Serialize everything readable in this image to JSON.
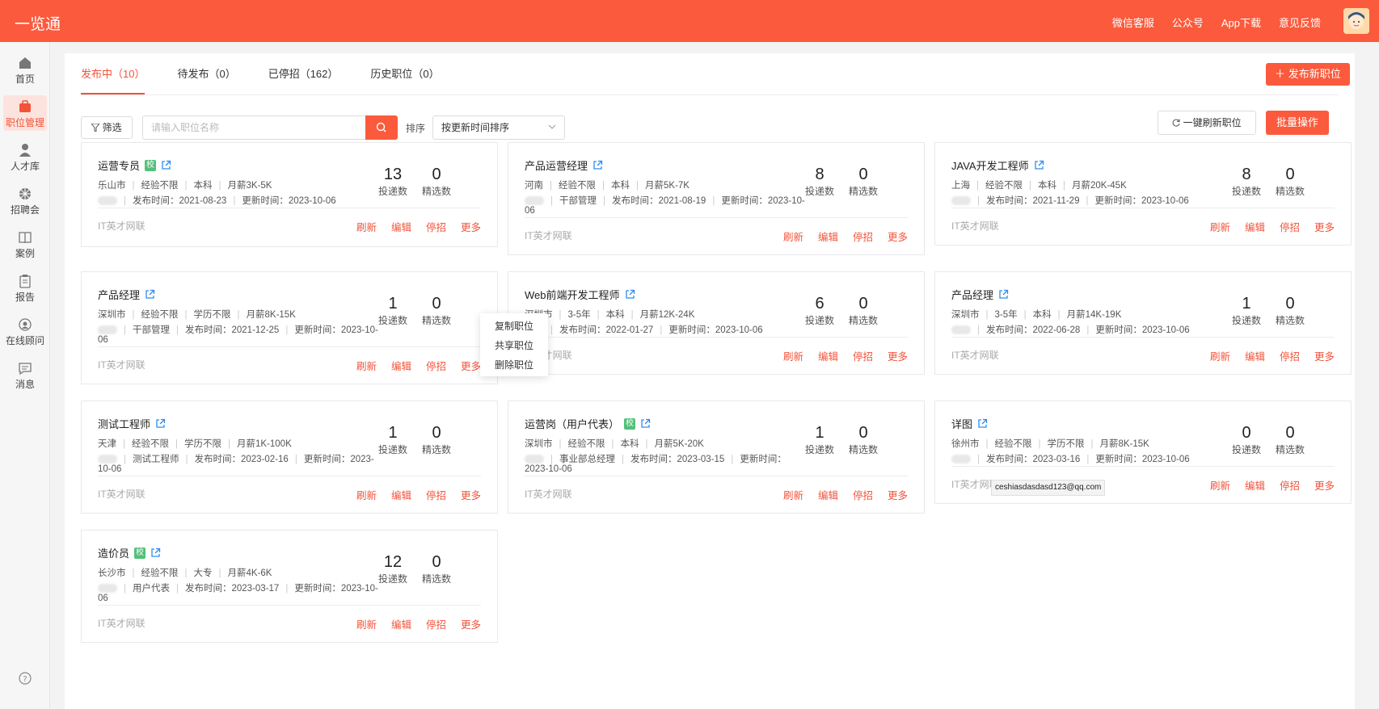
{
  "app": {
    "logo": "一览通",
    "top_links": [
      "微信客服",
      "公众号",
      "App下载",
      "意见反馈"
    ]
  },
  "sidebar": {
    "items": [
      {
        "label": "首页",
        "icon": "home-icon"
      },
      {
        "label": "职位管理",
        "icon": "briefcase-icon",
        "active": true
      },
      {
        "label": "人才库",
        "icon": "person-icon"
      },
      {
        "label": "招聘会",
        "icon": "fair-icon"
      },
      {
        "label": "案例",
        "icon": "book-icon"
      },
      {
        "label": "报告",
        "icon": "clipboard-icon"
      },
      {
        "label": "在线顾问",
        "icon": "consultant-icon"
      },
      {
        "label": "消息",
        "icon": "message-icon"
      }
    ],
    "help_icon": "help-icon"
  },
  "tabs": [
    {
      "label": "发布中（10）",
      "active": true
    },
    {
      "label": "待发布（0）"
    },
    {
      "label": "已停招（162）"
    },
    {
      "label": "历史职位（0）"
    }
  ],
  "toolbar": {
    "publish_label": "发布新职位",
    "filter_label": "筛选",
    "search_placeholder": "请输入职位名称",
    "sort_label": "排序",
    "sort_value": "按更新时间排序",
    "refresh_all_label": "一键刷新职位",
    "batch_label": "批量操作"
  },
  "labels": {
    "delivered": "投递数",
    "selected": "精选数",
    "source": "IT英才网联",
    "refresh": "刷新",
    "edit": "编辑",
    "pause": "停招",
    "more": "更多"
  },
  "cards": [
    {
      "title": "运营专员",
      "badge": "校",
      "city": "乐山市",
      "exp": "经验不限",
      "edu": "本科",
      "salary": "月薪3K-5K",
      "dept": "",
      "publish": "发布时间：2021-08-23",
      "update": "更新时间：2023-10-06",
      "delivered": "13",
      "selected": "0"
    },
    {
      "title": "产品运营经理",
      "badge": "",
      "city": "河南",
      "exp": "经验不限",
      "edu": "本科",
      "salary": "月薪5K-7K",
      "dept": "干部管理",
      "publish": "发布时间：2021-08-19",
      "update": "更新时间：2023-10-06",
      "delivered": "8",
      "selected": "0"
    },
    {
      "title": "JAVA开发工程师",
      "badge": "",
      "city": "上海",
      "exp": "经验不限",
      "edu": "本科",
      "salary": "月薪20K-45K",
      "dept": "",
      "publish": "发布时间：2021-11-29",
      "update": "更新时间：2023-10-06",
      "delivered": "8",
      "selected": "0"
    },
    {
      "title": "产品经理",
      "badge": "",
      "city": "深圳市",
      "exp": "经验不限",
      "edu": "学历不限",
      "salary": "月薪8K-15K",
      "dept": "干部管理",
      "publish": "发布时间：2021-12-25",
      "update": "更新时间：2023-10-06",
      "delivered": "1",
      "selected": "0"
    },
    {
      "title": "Web前端开发工程师",
      "badge": "",
      "city": "深圳市",
      "exp": "3-5年",
      "edu": "本科",
      "salary": "月薪12K-24K",
      "dept": "",
      "publish": "发布时间：2022-01-27",
      "update": "更新时间：2023-10-06",
      "delivered": "6",
      "selected": "0"
    },
    {
      "title": "产品经理",
      "badge": "",
      "city": "深圳市",
      "exp": "3-5年",
      "edu": "本科",
      "salary": "月薪14K-19K",
      "dept": "",
      "publish": "发布时间：2022-06-28",
      "update": "更新时间：2023-10-06",
      "delivered": "1",
      "selected": "0"
    },
    {
      "title": "测试工程师",
      "badge": "",
      "city": "天津",
      "exp": "经验不限",
      "edu": "学历不限",
      "salary": "月薪1K-100K",
      "dept": "测试工程师",
      "publish": "发布时间：2023-02-16",
      "update": "更新时间：2023-10-06",
      "delivered": "1",
      "selected": "0"
    },
    {
      "title": "运营岗（用户代表）",
      "badge": "校",
      "city": "深圳市",
      "exp": "经验不限",
      "edu": "本科",
      "salary": "月薪5K-20K",
      "dept": "事业部总经理",
      "publish": "发布时间：2023-03-15",
      "update": "更新时间：2023-10-06",
      "delivered": "1",
      "selected": "0"
    },
    {
      "title": "详图",
      "badge": "",
      "city": "徐州市",
      "exp": "经验不限",
      "edu": "学历不限",
      "salary": "月薪8K-15K",
      "dept": "",
      "publish": "发布时间：2023-03-16",
      "update": "更新时间：2023-10-06",
      "delivered": "0",
      "selected": "0"
    },
    {
      "title": "造价员",
      "badge": "校",
      "city": "长沙市",
      "exp": "经验不限",
      "edu": "大专",
      "salary": "月薪4K-6K",
      "dept": "用户代表",
      "publish": "发布时间：2023-03-17",
      "update": "更新时间：2023-10-06",
      "delivered": "12",
      "selected": "0"
    }
  ],
  "dropdown": {
    "items": [
      "复制职位",
      "共享职位",
      "删除职位"
    ]
  },
  "tooltip": "ceshiasdasdasd123@qq.com",
  "colors": {
    "accent": "#fb5a3c",
    "badge": "#52c07a",
    "link": "#2d8cf0"
  }
}
